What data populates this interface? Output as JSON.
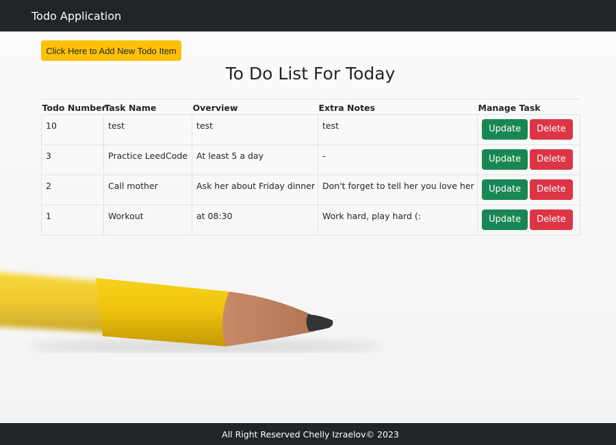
{
  "navbar": {
    "brand": "Todo Application"
  },
  "main": {
    "add_button_label": "Click Here to Add New Todo Item",
    "title": "To Do List For Today"
  },
  "table": {
    "headers": [
      "Todo Number",
      "Task Name",
      "Overview",
      "Extra Notes",
      "Manage Task"
    ],
    "rows": [
      {
        "number": "10",
        "task": "test",
        "overview": "test",
        "notes": "test",
        "update": "Update",
        "delete": "Delete"
      },
      {
        "number": "3",
        "task": "Practice LeedCode",
        "overview": "At least 5 a day",
        "notes": "-",
        "update": "Update",
        "delete": "Delete"
      },
      {
        "number": "2",
        "task": "Call mother",
        "overview": "Ask her about Friday dinner",
        "notes": "Don't forget to tell her you love her",
        "update": "Update",
        "delete": "Delete"
      },
      {
        "number": "1",
        "task": "Workout",
        "overview": "at 08:30",
        "notes": "Work hard, play hard (:",
        "update": "Update",
        "delete": "Delete"
      }
    ]
  },
  "footer": {
    "text": "All Right Reserved Chelly Izraelov© 2023"
  },
  "colors": {
    "navbar": "#212529",
    "add_button": "#ffc107",
    "update_button": "#198754",
    "delete_button": "#dc3545",
    "footer": "#212529"
  },
  "decoration": {
    "background_image": "pencil"
  }
}
